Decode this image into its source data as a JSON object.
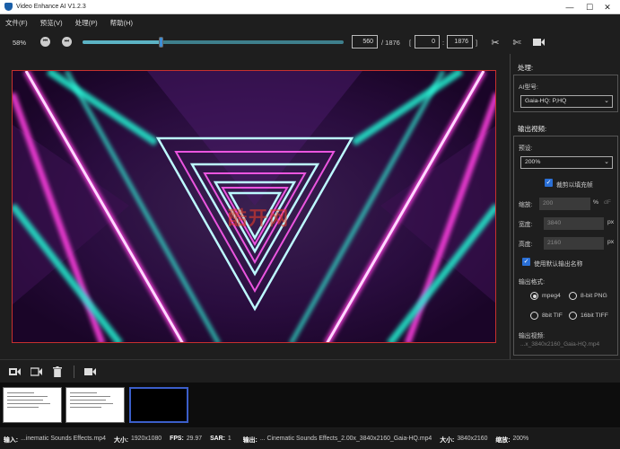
{
  "window": {
    "title": "Video Enhance AI V1.2.3",
    "controls": [
      "—",
      "☐",
      "✕"
    ]
  },
  "menu": [
    {
      "label": "文件(F)"
    },
    {
      "label": "预览(V)"
    },
    {
      "label": "处理(P)"
    },
    {
      "label": "帮助(H)"
    }
  ],
  "toolbar": {
    "zoom": "58%",
    "timeline_progress": 0.3,
    "current_frame": "560",
    "total_frames": "/ 1876",
    "range_open": "[",
    "range_start": "0",
    "range_sep": ":",
    "range_end": "1876",
    "range_close": "]"
  },
  "video": {
    "watermark": "酷开网"
  },
  "panel": {
    "process_title": "处理:",
    "ai_model_label": "AI型号:",
    "ai_model_value": "Gaia-HQ: P,HQ",
    "output_video_title": "输出视频:",
    "preset_label": "预设:",
    "preset_value": "200%",
    "crop_fill_label": "裁剪以填充帧",
    "crop_fill_checked": true,
    "scale_label": "缩放:",
    "scale_value": "200",
    "scale_unit": "%",
    "scale_alt_unit": "dF",
    "width_label": "宽度:",
    "width_value": "3840",
    "width_unit": "px",
    "height_label": "高度:",
    "height_value": "2160",
    "height_unit": "px",
    "default_name_label": "使用默认输出名称",
    "default_name_checked": true,
    "output_format_label": "输出格式:",
    "formats": [
      {
        "label": "mpeg4",
        "selected": true
      },
      {
        "label": "8-bit PNG",
        "selected": false
      },
      {
        "label": "8bit TIF",
        "selected": false
      },
      {
        "label": "16bit TIFF",
        "selected": false
      }
    ],
    "output_video_label": "输出视频:",
    "output_video_file": "...x_3840x2160_Gaia-HQ.mp4"
  },
  "status": {
    "input_label": "输入:",
    "input_value": "...inematic Sounds Effects.mp4",
    "size_label": "大小:",
    "size_value": "1920x1080",
    "fps_label": "FPS:",
    "fps_value": "29.97",
    "sar_label": "SAR:",
    "sar_value": "1",
    "output_label": "输出:",
    "output_value": "... Cinematic Sounds Effects_2.00x_3840x2160_Gaia-HQ.mp4",
    "out_size_label": "大小:",
    "out_size_value": "3840x2160",
    "out_scale_label": "缩放:",
    "out_scale_value": "200%"
  },
  "colors": {
    "accent": "#2a6fd6",
    "video_border": "#c7302e",
    "timeline": "#3e7f8c",
    "thumb_selected": "#3b5ec9"
  }
}
